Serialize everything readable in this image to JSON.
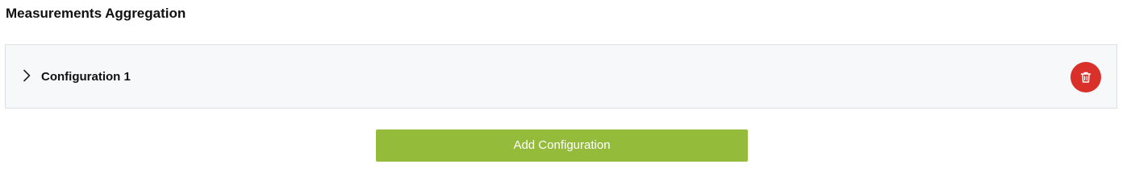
{
  "section": {
    "title": "Measurements Aggregation"
  },
  "configurations": [
    {
      "label": "Configuration 1",
      "expanded": false,
      "toggle_icon": "chevron-right-icon",
      "delete_icon": "trash-icon"
    }
  ],
  "actions": {
    "add_label": "Add Configuration"
  },
  "colors": {
    "panel_background": "#f7f8fa",
    "panel_border": "#dcdfe3",
    "delete_button": "#d9312a",
    "add_button": "#94bb3a",
    "add_button_text": "#ffffff"
  }
}
